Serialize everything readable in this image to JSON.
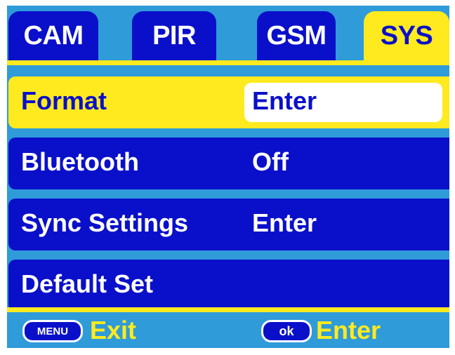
{
  "tabs": [
    {
      "label": "CAM",
      "active": false
    },
    {
      "label": "PIR",
      "active": false
    },
    {
      "label": "GSM",
      "active": false
    },
    {
      "label": "SYS",
      "active": true
    }
  ],
  "menu": [
    {
      "label": "Format",
      "value": "Enter",
      "selected": true
    },
    {
      "label": "Bluetooth",
      "value": "Off",
      "selected": false
    },
    {
      "label": "Sync Settings",
      "value": "Enter",
      "selected": false
    },
    {
      "label": "Default Set",
      "value": "",
      "selected": false
    }
  ],
  "footer": {
    "menu_key": "MENU",
    "exit_label": "Exit",
    "ok_key": "ok",
    "enter_label": "Enter"
  },
  "colors": {
    "background": "#2f9bd9",
    "item": "#0a10c9",
    "highlight": "#ffea1f",
    "text": "#ffffff"
  }
}
